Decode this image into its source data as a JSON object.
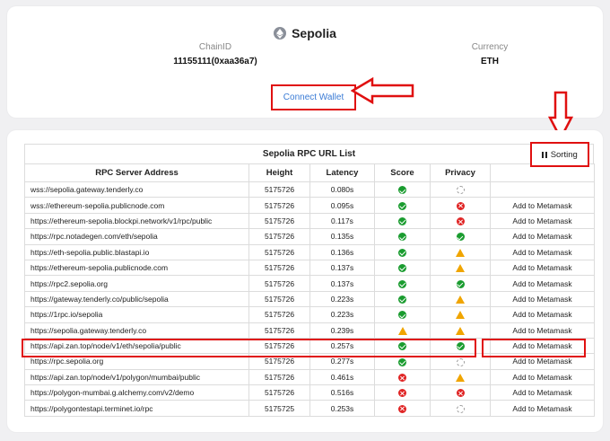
{
  "network": {
    "name": "Sepolia",
    "icon": "ethereum-icon",
    "chain_id_label": "ChainID",
    "chain_id_value": "11155111(0xaa36a7)",
    "currency_label": "Currency",
    "currency_value": "ETH"
  },
  "connect_button": {
    "label": "Connect Wallet"
  },
  "rpc_table": {
    "title": "Sepolia RPC URL List",
    "sorting_label": "Sorting",
    "columns": [
      "RPC Server Address",
      "Height",
      "Latency",
      "Score",
      "Privacy",
      ""
    ],
    "rows": [
      {
        "address": "wss://sepolia.gateway.tenderly.co",
        "height": "5175726",
        "latency": "0.080s",
        "score": "ok",
        "privacy": "unknown",
        "action": ""
      },
      {
        "address": "wss://ethereum-sepolia.publicnode.com",
        "height": "5175726",
        "latency": "0.095s",
        "score": "ok",
        "privacy": "bad",
        "action": "Add to Metamask"
      },
      {
        "address": "https://ethereum-sepolia.blockpi.network/v1/rpc/public",
        "height": "5175726",
        "latency": "0.117s",
        "score": "ok",
        "privacy": "bad",
        "action": "Add to Metamask"
      },
      {
        "address": "https://rpc.notadegen.com/eth/sepolia",
        "height": "5175726",
        "latency": "0.135s",
        "score": "ok",
        "privacy": "ok",
        "action": "Add to Metamask"
      },
      {
        "address": "https://eth-sepolia.public.blastapi.io",
        "height": "5175726",
        "latency": "0.136s",
        "score": "ok",
        "privacy": "warn",
        "action": "Add to Metamask"
      },
      {
        "address": "https://ethereum-sepolia.publicnode.com",
        "height": "5175726",
        "latency": "0.137s",
        "score": "ok",
        "privacy": "warn",
        "action": "Add to Metamask"
      },
      {
        "address": "https://rpc2.sepolia.org",
        "height": "5175726",
        "latency": "0.137s",
        "score": "ok",
        "privacy": "ok",
        "action": "Add to Metamask"
      },
      {
        "address": "https://gateway.tenderly.co/public/sepolia",
        "height": "5175726",
        "latency": "0.223s",
        "score": "ok",
        "privacy": "warn",
        "action": "Add to Metamask"
      },
      {
        "address": "https://1rpc.io/sepolia",
        "height": "5175726",
        "latency": "0.223s",
        "score": "ok",
        "privacy": "warn",
        "action": "Add to Metamask"
      },
      {
        "address": "https://sepolia.gateway.tenderly.co",
        "height": "5175726",
        "latency": "0.239s",
        "score": "warn",
        "privacy": "warn",
        "action": "Add to Metamask"
      },
      {
        "address": "https://api.zan.top/node/v1/eth/sepolia/public",
        "height": "5175726",
        "latency": "0.257s",
        "score": "ok",
        "privacy": "ok",
        "action": "Add to Metamask"
      },
      {
        "address": "https://rpc.sepolia.org",
        "height": "5175726",
        "latency": "0.277s",
        "score": "ok",
        "privacy": "unknown",
        "action": "Add to Metamask"
      },
      {
        "address": "https://api.zan.top/node/v1/polygon/mumbai/public",
        "height": "5175726",
        "latency": "0.461s",
        "score": "bad",
        "privacy": "warn",
        "action": "Add to Metamask"
      },
      {
        "address": "https://polygon-mumbai.g.alchemy.com/v2/demo",
        "height": "5175726",
        "latency": "0.516s",
        "score": "bad",
        "privacy": "bad",
        "action": "Add to Metamask"
      },
      {
        "address": "https://polygontestapi.terminet.io/rpc",
        "height": "5175725",
        "latency": "0.253s",
        "score": "bad",
        "privacy": "unknown",
        "action": "Add to Metamask"
      }
    ]
  },
  "colors": {
    "highlight": "#e01010",
    "link": "#3a7bd5",
    "ok": "#1a9c2f",
    "bad": "#e02424",
    "warn": "#f0a500"
  }
}
